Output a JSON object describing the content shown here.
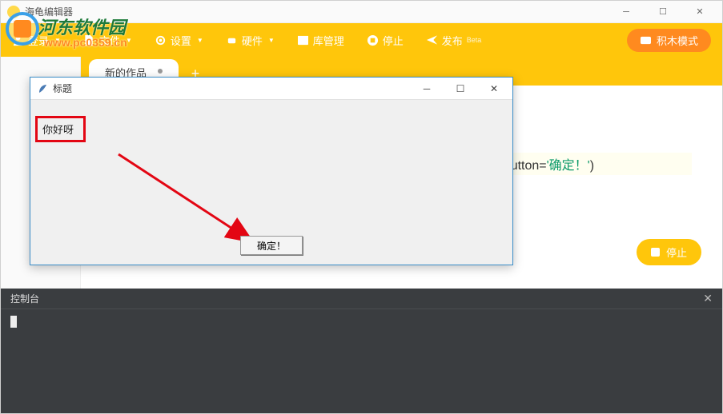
{
  "app": {
    "title": "海龟编辑器"
  },
  "toolbar": {
    "login": "登录",
    "file": "文件",
    "settings": "设置",
    "hardware": "硬件",
    "library": "库管理",
    "stop": "停止",
    "publish": "发布",
    "publish_suffix": "Beta",
    "blocks_mode": "积木模式"
  },
  "tab": {
    "name": "新的作品"
  },
  "code": {
    "visible_fragment": "ok_button=",
    "string_value": "'确定！'",
    "tail": ")"
  },
  "side": {
    "stop": "停止"
  },
  "console": {
    "title": "控制台"
  },
  "dialog": {
    "title": "标题",
    "message": "你好呀",
    "ok_label": "确定！"
  },
  "watermark": {
    "text": "河东软件园",
    "url": "www.pc0359.cn"
  }
}
